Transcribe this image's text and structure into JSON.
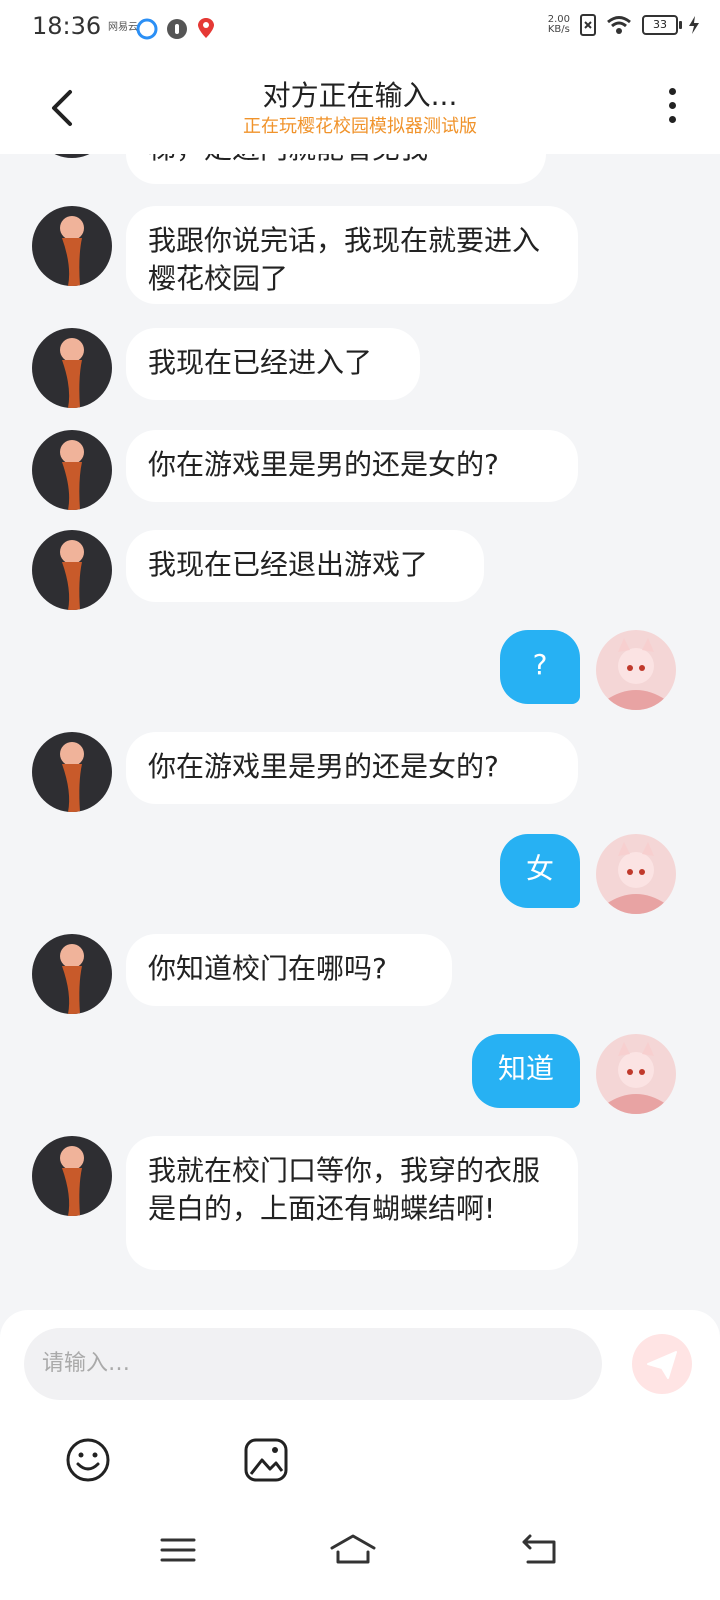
{
  "status_bar": {
    "time": "18:36",
    "app_label": "网易云",
    "net_speed_value": "2.00",
    "net_speed_unit": "KB/s",
    "battery": "33"
  },
  "header": {
    "title": "对方正在输入...",
    "subtitle": "正在玩樱花校园模拟器测试版"
  },
  "messages": [
    {
      "side": "left",
      "text": "梯，走进门就能看见我"
    },
    {
      "side": "left",
      "text": "我跟你说完话，我现在就要进入樱花校园了"
    },
    {
      "side": "left",
      "text": "我现在已经进入了"
    },
    {
      "side": "left",
      "text": "你在游戏里是男的还是女的?"
    },
    {
      "side": "left",
      "text": "我现在已经退出游戏了"
    },
    {
      "side": "right",
      "text": "?"
    },
    {
      "side": "left",
      "text": "你在游戏里是男的还是女的?"
    },
    {
      "side": "right",
      "text": "女"
    },
    {
      "side": "left",
      "text": "你知道校门在哪吗?"
    },
    {
      "side": "right",
      "text": "知道"
    },
    {
      "side": "left",
      "text": "我就在校门口等你，我穿的衣服是白的，上面还有蝴蝶结啊!"
    }
  ],
  "composer": {
    "placeholder": "请输入…",
    "send_color": "#fe8a8a",
    "accent": "#27b1f3",
    "subtitle_color": "#f0932b"
  },
  "icons": {
    "back": "chevron-left-icon",
    "more": "more-vertical-icon",
    "emoji": "emoji-icon",
    "image": "image-icon",
    "send": "send-icon"
  }
}
